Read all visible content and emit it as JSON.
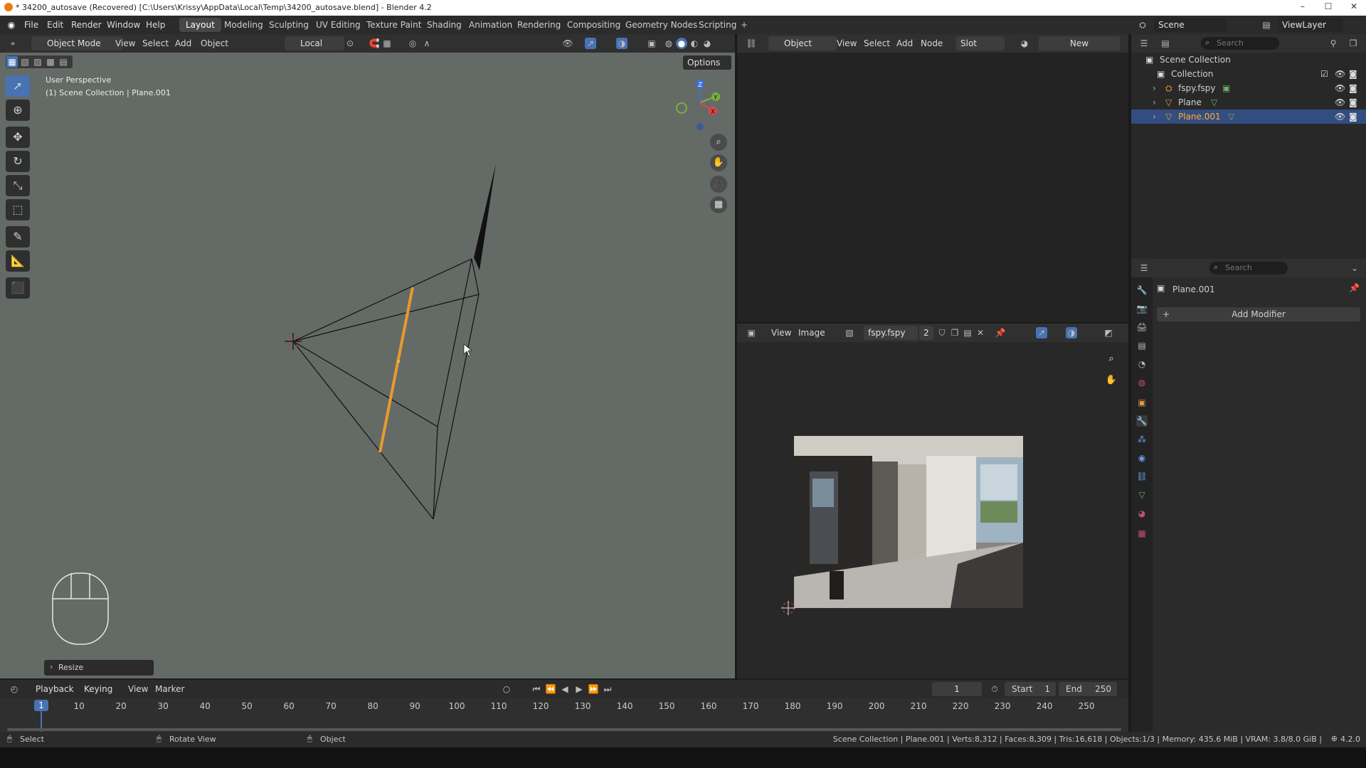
{
  "window": {
    "title": "* 34200_autosave (Recovered) [C:\\Users\\Krissy\\AppData\\Local\\Temp\\34200_autosave.blend] - Blender 4.2",
    "minimize": "–",
    "maximize": "☐",
    "close": "✕"
  },
  "menubar": {
    "file": "File",
    "edit": "Edit",
    "render": "Render",
    "window": "Window",
    "help": "Help"
  },
  "workspaces": [
    "Layout",
    "Modeling",
    "Sculpting",
    "UV Editing",
    "Texture Paint",
    "Shading",
    "Animation",
    "Rendering",
    "Compositing",
    "Geometry Nodes",
    "Scripting"
  ],
  "active_workspace": "Layout",
  "scene": {
    "label": "Scene",
    "view_layer": "ViewLayer"
  },
  "viewport": {
    "mode": "Object Mode",
    "menu": [
      "View",
      "Select",
      "Add",
      "Object"
    ],
    "transform_orientation": "Local",
    "options": "Options",
    "perspective_label": "User Perspective",
    "collection_label": "(1) Scene Collection | Plane.001",
    "last_op": "Resize",
    "gizmo": {
      "z": "Z",
      "y": "Y",
      "x": "X"
    }
  },
  "shader_editor": {
    "object": "Object",
    "menu": [
      "View",
      "Select",
      "Add",
      "Node"
    ],
    "slot": "Slot",
    "new": "New"
  },
  "image_editor": {
    "menu": [
      "View",
      "Image"
    ],
    "image_name": "fspy.fspy",
    "users": "2"
  },
  "outliner": {
    "search_placeholder": "Search",
    "items": [
      {
        "label": "Scene Collection"
      },
      {
        "label": "Collection"
      },
      {
        "label": "fspy.fspy"
      },
      {
        "label": "Plane"
      },
      {
        "label": "Plane.001"
      }
    ]
  },
  "properties": {
    "search_placeholder": "Search",
    "object_name": "Plane.001",
    "add_modifier": "Add Modifier"
  },
  "timeline": {
    "menu": [
      "Playback",
      "Keying",
      "View",
      "Marker"
    ],
    "current_frame": "1",
    "start_label": "Start",
    "start": "1",
    "end_label": "End",
    "end": "250",
    "ticks": [
      "1",
      "10",
      "20",
      "30",
      "40",
      "50",
      "60",
      "70",
      "80",
      "90",
      "100",
      "110",
      "120",
      "130",
      "140",
      "150",
      "160",
      "170",
      "180",
      "190",
      "200",
      "210",
      "220",
      "230",
      "240",
      "250"
    ]
  },
  "statusbar": {
    "select": "Select",
    "rotate": "Rotate View",
    "object": "Object",
    "info": "Scene Collection | Plane.001 | Verts:8,312 | Faces:8,309 | Tris:16,618 | Objects:1/3 | Memory: 435.6 MiB | VRAM: 3.8/8.0 GiB |",
    "version": "4.2.0"
  },
  "colors": {
    "selected_edge": "#e89a2c",
    "viewport_bg": "#646b66",
    "accent_blue": "#4872b3",
    "selected_row": "#334d80"
  }
}
